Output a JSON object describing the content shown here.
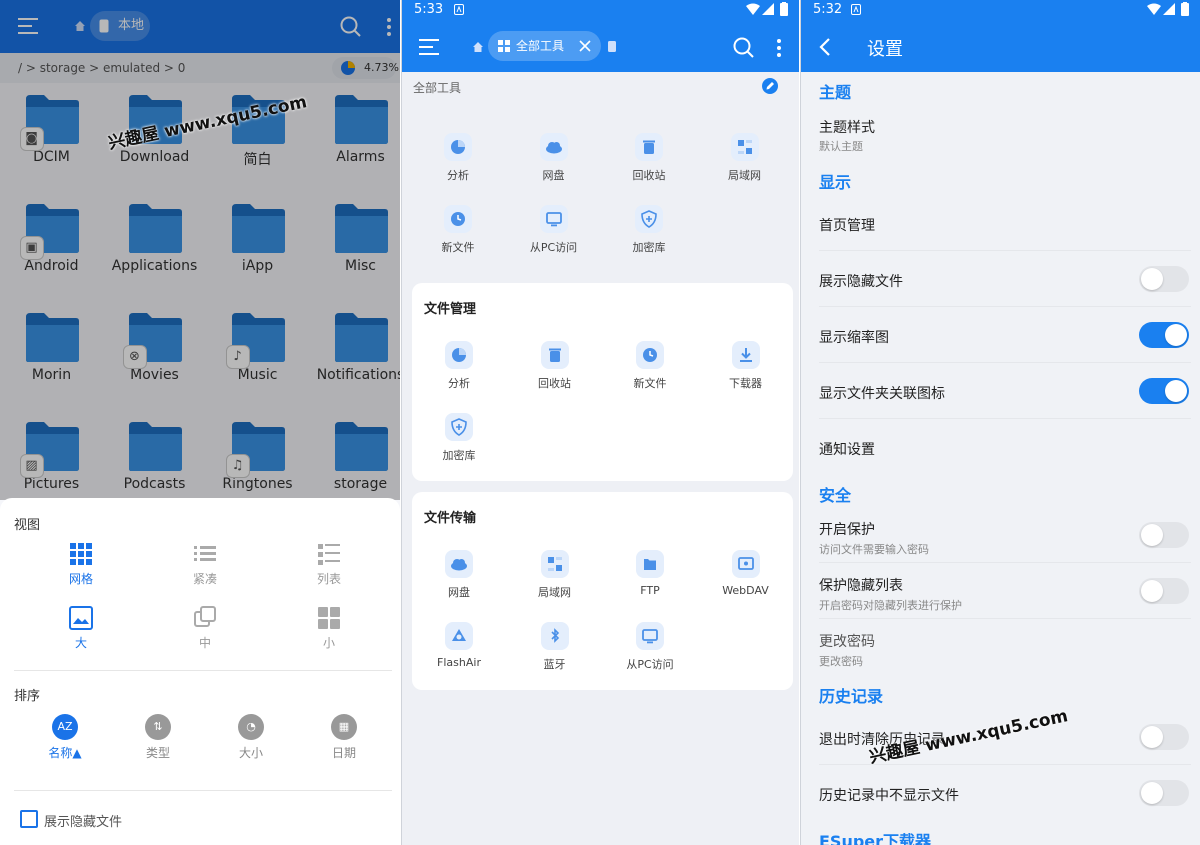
{
  "screen1": {
    "tab_label": "本地",
    "path": "/  > storage > emulated >  0",
    "usage_percent": "4.73%",
    "folders": [
      {
        "label": "DCIM",
        "badge": "camera-icon"
      },
      {
        "label": "Download",
        "badge": ""
      },
      {
        "label": "简白",
        "badge": ""
      },
      {
        "label": "Alarms",
        "badge": ""
      },
      {
        "label": "Android",
        "badge": "package-icon"
      },
      {
        "label": "Applications",
        "badge": ""
      },
      {
        "label": "iApp",
        "badge": ""
      },
      {
        "label": "Misc",
        "badge": ""
      },
      {
        "label": "Morin",
        "badge": ""
      },
      {
        "label": "Movies",
        "badge": "film-icon"
      },
      {
        "label": "Music",
        "badge": "music-icon"
      },
      {
        "label": "Notifications",
        "badge": ""
      },
      {
        "label": "Pictures",
        "badge": "image-icon"
      },
      {
        "label": "Podcasts",
        "badge": ""
      },
      {
        "label": "Ringtones",
        "badge": "bell-icon"
      },
      {
        "label": "storage",
        "badge": ""
      }
    ],
    "view_title": "视图",
    "view_options": [
      {
        "label": "网格",
        "selected": true
      },
      {
        "label": "紧凑",
        "selected": false
      },
      {
        "label": "列表",
        "selected": false
      },
      {
        "label": "大",
        "selected": true
      },
      {
        "label": "中",
        "selected": false
      },
      {
        "label": "小",
        "selected": false
      }
    ],
    "sort_title": "排序",
    "sort_options": [
      {
        "label": "名称▲",
        "icon_text": "AZ",
        "selected": true
      },
      {
        "label": "类型",
        "icon_text": "⇅",
        "selected": false
      },
      {
        "label": "大小",
        "icon_text": "◔",
        "selected": false
      },
      {
        "label": "日期",
        "icon_text": "▦",
        "selected": false
      }
    ],
    "show_hidden_label": "展示隐藏文件"
  },
  "screen2": {
    "time": "5:33",
    "tab_label": "全部工具",
    "all_tools_label": "全部工具",
    "all_tools": [
      "分析",
      "网盘",
      "回收站",
      "局域网",
      "新文件",
      "从PC访问",
      "加密库"
    ],
    "file_mgmt_title": "文件管理",
    "file_mgmt": [
      "分析",
      "回收站",
      "新文件",
      "下载器",
      "加密库"
    ],
    "file_transfer_title": "文件传输",
    "file_transfer": [
      "网盘",
      "局域网",
      "FTP",
      "WebDAV",
      "FlashAir",
      "蓝牙",
      "从PC访问"
    ]
  },
  "screen3": {
    "time": "5:32",
    "title": "设置",
    "sections": {
      "theme": "主题",
      "display": "显示",
      "security": "安全",
      "history": "历史记录",
      "downloader": "ESuper下载器"
    },
    "theme_style": "主题样式",
    "theme_style_value": "默认主题",
    "home_manage": "首页管理",
    "show_hidden": "展示隐藏文件",
    "show_thumbnails": "显示缩率图",
    "show_folder_icons": "显示文件夹关联图标",
    "notification_settings": "通知设置",
    "enable_protection": "开启保护",
    "enable_protection_sub": "访问文件需要输入密码",
    "protect_hidden": "保护隐藏列表",
    "protect_hidden_sub": "开启密码对隐藏列表进行保护",
    "change_password": "更改密码",
    "change_password_sub": "更改密码",
    "clear_history": "退出时清除历史记录",
    "hide_history_files": "历史记录中不显示文件"
  },
  "watermark": "兴趣屋 www.xqu5.com",
  "colors": {
    "accent": "#1a73e8",
    "bar": "#1a80f0"
  }
}
